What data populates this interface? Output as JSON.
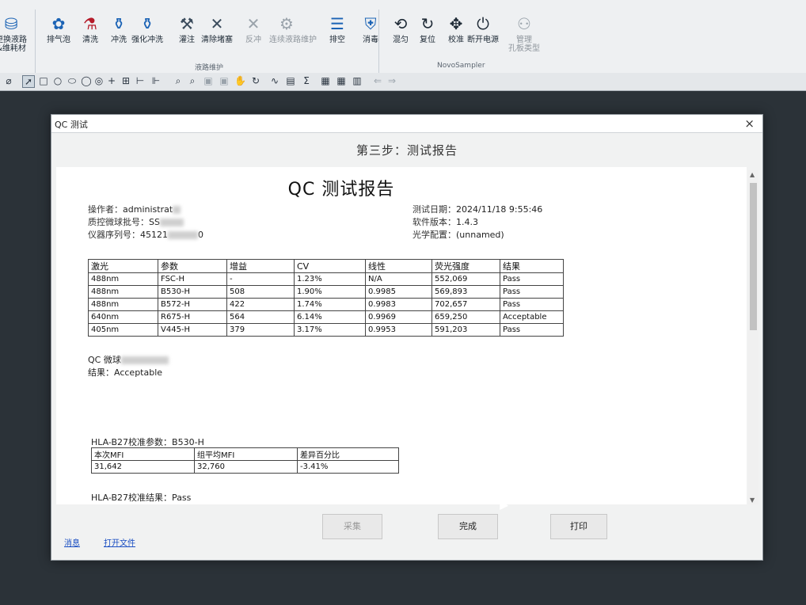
{
  "ribbon": {
    "buttons": [
      {
        "label": "更换液路\n&维耗材",
        "icon": "tubing-icon",
        "disabled": false
      },
      {
        "label": "排气泡",
        "icon": "bubble-icon",
        "disabled": false
      },
      {
        "label": "清洗",
        "icon": "clean-icon",
        "disabled": false
      },
      {
        "label": "冲洗",
        "icon": "rinse-icon",
        "disabled": false
      },
      {
        "label": "强化冲洗",
        "icon": "deep-rinse-icon",
        "disabled": false
      },
      {
        "label": "灌注",
        "icon": "prime-icon",
        "disabled": false
      },
      {
        "label": "清除堵塞",
        "icon": "unclog-icon",
        "disabled": false
      },
      {
        "label": "反冲",
        "icon": "backflush-icon",
        "disabled": true
      },
      {
        "label": "连续液路维护",
        "icon": "continuous-maintenance-icon",
        "disabled": true
      },
      {
        "label": "排空",
        "icon": "drain-icon",
        "disabled": false
      },
      {
        "label": "消毒",
        "icon": "disinfect-icon",
        "disabled": false
      },
      {
        "label": "混匀",
        "icon": "mix-icon",
        "disabled": false
      },
      {
        "label": "复位",
        "icon": "reset-icon",
        "disabled": false
      },
      {
        "label": "校准",
        "icon": "calibrate-icon",
        "disabled": false
      },
      {
        "label": "断开电源",
        "icon": "power-icon",
        "disabled": false
      },
      {
        "label": "管理\n孔板类型",
        "icon": "plate-icon",
        "disabled": true
      }
    ],
    "groups": {
      "fluidics": "液路维护",
      "sampler": "NovoSampler"
    }
  },
  "dialog": {
    "title": "QC 测试",
    "close": "×",
    "step": "第三步：测试报告",
    "report": {
      "title": "QC 测试报告",
      "operator_label": "操作者：",
      "operator_value": "administrat",
      "lot_label": "质控微球批号：",
      "lot_value": "SS",
      "serial_label": "仪器序列号：",
      "serial_value": "45121",
      "serial_tail": "0",
      "date_label": "测试日期：",
      "date_value": "2024/11/18 9:55:46",
      "software_label": "软件版本：",
      "software_value": "1.4.3",
      "optics_label": "光学配置：",
      "optics_value": "(unnamed)",
      "qc_headers": [
        "激光",
        "参数",
        "增益",
        "CV",
        "线性",
        "荧光强度",
        "结果"
      ],
      "qc_rows": [
        [
          "488nm",
          "FSC-H",
          "-",
          "1.23%",
          "N/A",
          "552,069",
          "Pass"
        ],
        [
          "488nm",
          "B530-H",
          "508",
          "1.90%",
          "0.9985",
          "569,893",
          "Pass"
        ],
        [
          "488nm",
          "B572-H",
          "422",
          "1.74%",
          "0.9983",
          "702,657",
          "Pass"
        ],
        [
          "640nm",
          "R675-H",
          "564",
          "6.14%",
          "0.9969",
          "659,250",
          "Acceptable"
        ],
        [
          "405nm",
          "V445-H",
          "379",
          "3.17%",
          "0.9953",
          "591,203",
          "Pass"
        ]
      ],
      "qc_bead_label": "QC 微球",
      "result_label": "结果：",
      "result_value": "Acceptable",
      "hla_title": "HLA-B27校准参数：B530-H",
      "hla_headers": [
        "本次MFI",
        "组平均MFI",
        "差异百分比"
      ],
      "hla_row": [
        "31,642",
        "32,760",
        "-3.41%"
      ],
      "hla_result": "HLA-B27校准结果：Pass"
    },
    "buttons": {
      "collect": "采集",
      "finish": "完成",
      "print": "打印"
    },
    "links": {
      "message": "消息",
      "open_file": "打开文件"
    }
  }
}
